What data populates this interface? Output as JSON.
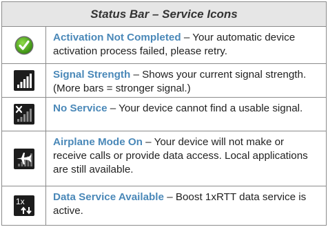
{
  "header": {
    "title": "Status Bar – Service Icons"
  },
  "rows": [
    {
      "icon": "activation-check-icon",
      "term": "Activation Not Completed",
      "sep": " – ",
      "desc": "Your automatic device activation process failed, please retry."
    },
    {
      "icon": "signal-strength-icon",
      "term": "Signal Strength",
      "sep": " – ",
      "desc": "Shows your current signal strength. (More bars = stronger signal.)"
    },
    {
      "icon": "no-service-icon",
      "term": "No Service",
      "sep": " – ",
      "desc": "Your device cannot find a usable signal."
    },
    {
      "icon": "airplane-mode-icon",
      "term": "Airplane Mode On",
      "sep": " – ",
      "desc": "Your device will not make or receive calls or provide data access. Local applications are still available."
    },
    {
      "icon": "data-service-icon",
      "term": "Data Service Available",
      "sep": " – ",
      "desc": "Boost 1xRTT data service is active.",
      "icon_text": "1x"
    }
  ],
  "colors": {
    "term": "#4a88b8",
    "check_green": "#4caf1e",
    "icon_bg": "#222222"
  }
}
